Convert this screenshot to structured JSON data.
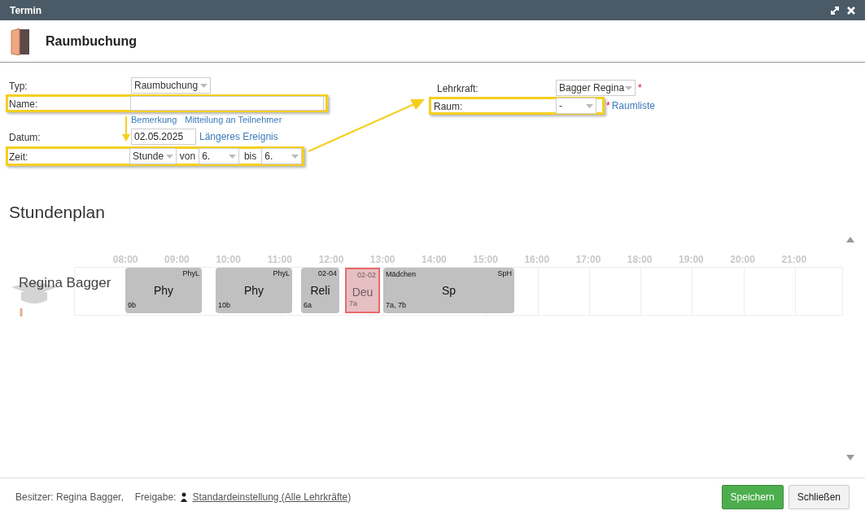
{
  "window": {
    "title": "Termin"
  },
  "header": {
    "title": "Raumbuchung"
  },
  "form": {
    "typ": {
      "label": "Typ:",
      "value": "Raumbuchung"
    },
    "name": {
      "label": "Name:"
    },
    "links": [
      "Bemerkung",
      "Mitteilung an Teilnehmer"
    ],
    "datum": {
      "label": "Datum:",
      "value": "02.05.2025",
      "link": "Längeres Ereignis"
    },
    "zeit": {
      "label": "Zeit:",
      "unit": "Stunde",
      "from_label": "von",
      "from": "6.",
      "to_label": "bis",
      "to": "6."
    },
    "lehrkraft": {
      "label": "Lehrkraft:",
      "value": "Bagger Regina",
      "required": "*"
    },
    "raum": {
      "label": "Raum:",
      "value": "-",
      "required": "*",
      "link": "Raumliste"
    }
  },
  "schedule": {
    "title": "Stundenplan",
    "hours": [
      "08:00",
      "09:00",
      "10:00",
      "11:00",
      "12:00",
      "13:00",
      "14:00",
      "15:00",
      "16:00",
      "17:00",
      "18:00",
      "19:00",
      "20:00",
      "21:00"
    ],
    "person": "Regina Bagger",
    "lessons": [
      {
        "subject": "Phy",
        "room": "PhyL",
        "classes": "9b",
        "highlighted": false
      },
      {
        "subject": "Phy",
        "room": "PhyL",
        "classes": "10b",
        "highlighted": false
      },
      {
        "subject": "Reli",
        "room": "02-04",
        "classes": "6a",
        "highlighted": false
      },
      {
        "subject": "Deu",
        "room": "02-02",
        "classes": "7a",
        "highlighted": true
      },
      {
        "subject": "Sp",
        "group": "Mädchen",
        "room": "SpH",
        "classes": "7a, 7b",
        "highlighted": false
      }
    ]
  },
  "footer": {
    "owner": "Besitzer: Regina Bagger,",
    "share_label": "Freigabe:",
    "share_link": "Standardeinstellung (Alle Lehrkräfte)",
    "buttons": [
      "Speichern",
      "Schließen"
    ]
  }
}
